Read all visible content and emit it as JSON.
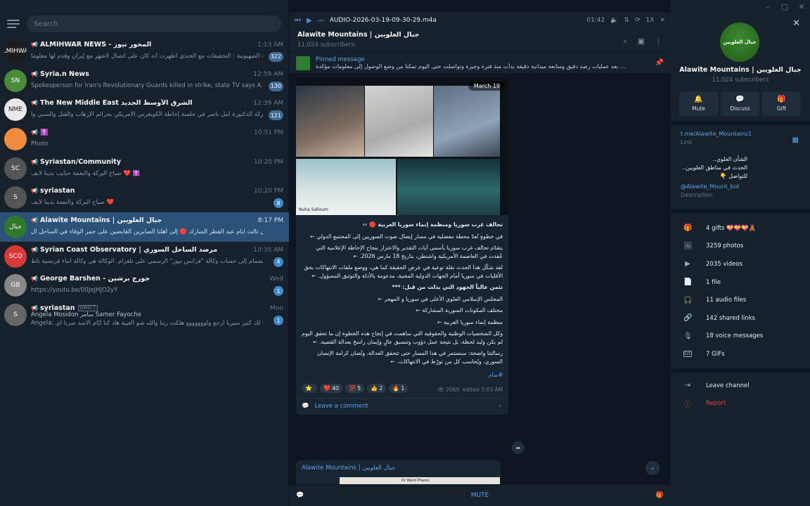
{
  "window": {
    "controls": [
      "–",
      "▢",
      "✕"
    ]
  },
  "search": {
    "placeholder": "Search"
  },
  "chats": [
    {
      "name": "ALMIHWAR NEWS - المحور نيوز",
      "time": "1:13 AM",
      "preview": "الشرطة الصهيونية : التحقيقات مع الجندي أظهرت أنه كان على اتصال لأشهر مع إيران وقدم لها معلوما...",
      "badge": "322",
      "avatar_color": "#1c1c1c",
      "avatar_text": "ALMIHWAR"
    },
    {
      "name": "Syria.n News",
      "time": "12:59 AM",
      "preview": "Spokesperson for Iran's Revolutionary Guards killed in strike, state TV says  A...",
      "badge": "130",
      "avatar_color": "#4a8c3a",
      "avatar_text": "SN"
    },
    {
      "name": "The New Middle East الشرق الأوسط الجديد",
      "time": "12:39 AM",
      "preview": "مشاركة الدكتورة أمل ناصر في جلسة إحاطة الكونغرس الأمريكي بجرائم الإرهاب والقتل والسبي وا...",
      "badge": "121",
      "avatar_color": "#e8e8e8",
      "avatar_text": "NME"
    },
    {
      "name": "✝️",
      "time": "10:51 PM",
      "preview": "Photo",
      "badge": "",
      "avatar_color": "#f08a3c",
      "avatar_text": ""
    },
    {
      "name": "Syriastan/Community",
      "time": "10:20 PM",
      "preview": "صباح البركة والنعمة حبايب بدينا لايف ❤️ ✝️",
      "badge": "",
      "avatar_color": "#555",
      "avatar_text": "SC"
    },
    {
      "name": "syriastan",
      "time": "10:20 PM",
      "preview": "صباح البركة والنعمة بدينا لايف ❤️",
      "badge": "8",
      "avatar_color": "#555",
      "avatar_text": "S"
    },
    {
      "name": "Alawite Mountains | جبال العلويين",
      "time": "8:17 PM",
      "preview": "في ثالث ايام عيد الفطر المبارك 🔴 إلى أهلنا الصابرين القابضين على جمر الوفاء في الساحل ال...",
      "badge": "",
      "avatar_color": "#2f7a2a",
      "avatar_text": "جبال"
    },
    {
      "name": "Syrian Coast Observatory | مرصد الساحل السوري",
      "time": "10:35 AM",
      "preview": "تدعوكم للانضمام إلى حساب وكالة \"فرانس نيوز\" الرسمي على تلغرام.  الوكالة هي وكالة أنباء فرنسية ناط...",
      "badge": "4",
      "avatar_color": "#d83a3a",
      "avatar_text": "SCO"
    },
    {
      "name": "George Barshen - جورج برشين",
      "time": "Wed",
      "preview": "https://youtu.be/00JeJHJO2yY",
      "badge": "1",
      "avatar_color": "#888",
      "avatar_text": "GB"
    },
    {
      "name": "syriastan",
      "tag": "DIRECT",
      "time": "Mon",
      "preview_line1": "Angela  Mosidon  سامر Samer  Fayoche",
      "preview": "Angela: اشتقنا لك كتير سيريا ارجع ولووووووو هلكت ربنا والله شو الغيبة هاد كنا أيّام الاسد صرنا أي...",
      "badge": "1",
      "avatar_color": "#666",
      "avatar_text": "S"
    }
  ],
  "player": {
    "file": "AUDIO-2026-03-19-09-30-29.m4a",
    "time": "01:42",
    "speed": "1X"
  },
  "channel": {
    "title": "Alawite Mountains | جبال العلويين",
    "subscribers": "11,024 subscribers"
  },
  "pinned": {
    "title": "Pinned message",
    "text": "بعد عمليات رصد دقيق ومتابعة ميدانية دقيقة بدأت منذ فترة وجيزة وتواصلت حتى اليوم تمكنا من وضع الوصول إلى معلومات مؤكدة ..."
  },
  "post": {
    "date": "March 19",
    "paragraphs": [
      "تحالف غرب سوريا ومنظمة إنماء سوريا الغربية 🔴 ››",
      "في خطوةٍ تُعدّ محطة مفصلية في مسار إيصال صوت السوريين إلى المجتمع الدولي ←",
      "يتقدّم تحالف غرب سوريا بأسمى آيات التقدير والاعتزاز بنجاح الإحاطة الإعلامية التي عُقدت في العاصمة الأمريكية واشنطن، بتاريخ 18 مارس 2026. ←",
      "لقد شكّل هذا الحدث نقلة نوعية في عرض الحقيقة كما هي، ووضع ملفات الانتهاكات بحق الأقليات في سوريا أمام الجهات الدولية المعنية، مدعومة بالأدلة والتوثيق المسؤول. ←",
      "نثمن عالياً الجهود التي بذلت من قبل: ***",
      "المجلس الإسلامي العلوي الأعلى في سوريا و المهجر ←",
      "مختلف المكونات السورية المشاركة ←",
      "منظمة إنماء سوريا الغربية ←",
      "وكل الشخصيات الوطنية والحقوقية التي ساهمت في إنجاح هذه الخطوة إن ما تحقق اليوم لم يكن وليد لحظة، بل نتيجة عمل دؤوب وتنسيق عالٍ وإيمان راسخ بعدالة القضية. ←",
      "رسالتنا واضحة: سنستمر في هذا المسار حتى تتحقق العدالة، وتُصان كرامة الإنسان السوري، ويُحاسب كل من تورّط في الانتهاكات. ←"
    ],
    "hashtag": "#سام",
    "reactions": [
      {
        "emoji": "⭐",
        "count": ""
      },
      {
        "emoji": "❤️",
        "count": "40"
      },
      {
        "emoji": "💯",
        "count": "5"
      },
      {
        "emoji": "👍",
        "count": "2"
      },
      {
        "emoji": "🔥",
        "count": "1"
      }
    ],
    "views": "2069",
    "edited": "edited 3:03 AM",
    "comment_label": "Leave a comment",
    "photo_label": "Nuha Salloum"
  },
  "post2": {
    "name": "Alawite Mountains | جبال العلويين",
    "preview_text": "Dr Walid Phares"
  },
  "bottom": {
    "mute": "MUTE"
  },
  "profile": {
    "name": "Alawite Mountains | جبال العلويين",
    "subscribers": "11,024 subscribers",
    "actions": [
      {
        "label": "Mute",
        "icon": "bell-icon"
      },
      {
        "label": "Discuss",
        "icon": "chat-icon"
      },
      {
        "label": "Gift",
        "icon": "gift-icon"
      }
    ],
    "link": "t.me/Alawite_Mountains1",
    "link_label": "Link",
    "description_lines": [
      "الشأن العلوي..",
      "الحدث في مناطق العلويين..",
      "للتواصل 👇"
    ],
    "bot": "@Alawite_Mount_bot",
    "description_label": "Description",
    "stats": [
      {
        "icon": "gift-icon",
        "text": "4 gifts 💝💝💝🧸"
      },
      {
        "icon": "photo-icon",
        "text": "3259 photos"
      },
      {
        "icon": "video-icon",
        "text": "2035 videos"
      },
      {
        "icon": "file-icon",
        "text": "1 file"
      },
      {
        "icon": "headphones-icon",
        "text": "11 audio files"
      },
      {
        "icon": "link-icon",
        "text": "142 shared links"
      },
      {
        "icon": "mic-icon",
        "text": "18 voice messages"
      },
      {
        "icon": "gif-icon",
        "text": "7 GIFs"
      }
    ],
    "leave": "Leave channel",
    "report": "Report"
  }
}
